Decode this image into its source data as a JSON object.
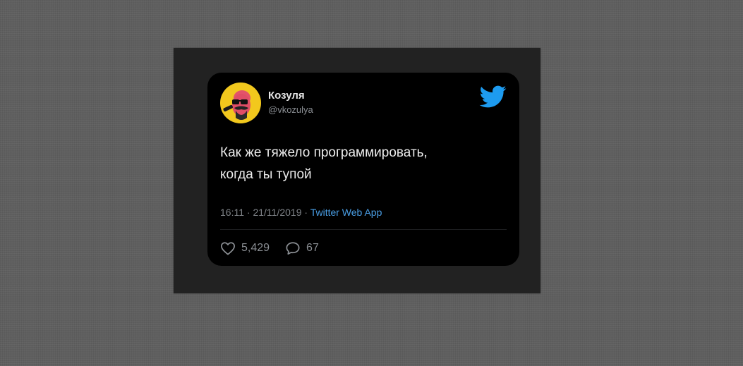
{
  "tweet": {
    "display_name": "Козуля",
    "handle": "@vkozulya",
    "text_lines": [
      "Как же тяжело программировать,",
      "когда ты тупой"
    ],
    "time": "16:11",
    "date": "21/11/2019",
    "separator": "·",
    "source_app": "Twitter Web App",
    "likes": "5,429",
    "replies": "67"
  },
  "icons": {
    "brand": "twitter-bird-icon",
    "like": "heart-icon",
    "reply": "speech-bubble-icon"
  },
  "colors": {
    "card_background": "#000000",
    "frame_background": "#222222",
    "page_background": "#5f5f5f",
    "accent_blue": "#1d9bf0",
    "link_blue": "#4a9fe6",
    "avatar_background": "#f2c81d",
    "muted_text": "#8b8f94"
  }
}
